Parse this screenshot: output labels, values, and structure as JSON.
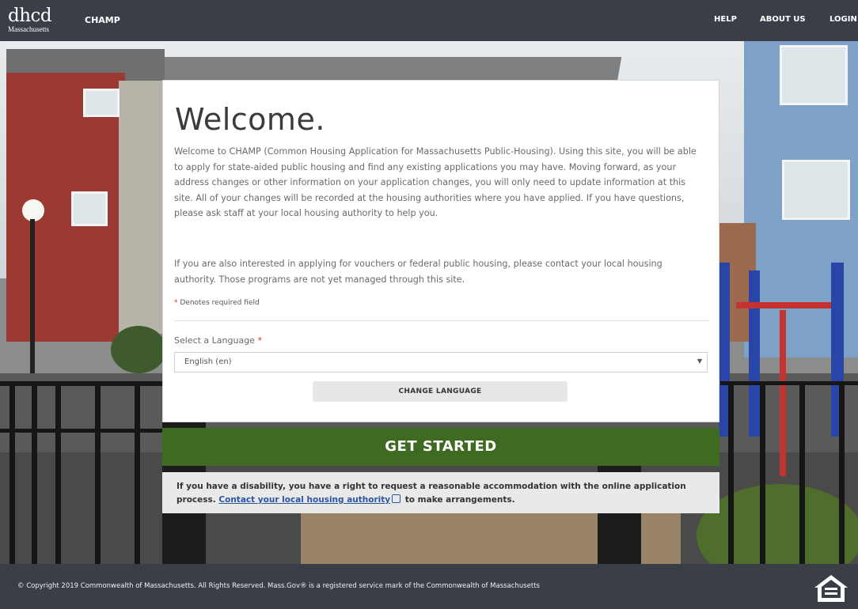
{
  "header": {
    "logo_main": "dhcd",
    "logo_sub": "Massachusetts",
    "brand": "CHAMP",
    "nav": [
      {
        "label": "HELP"
      },
      {
        "label": "ABOUT US"
      },
      {
        "label": "LOGIN"
      }
    ]
  },
  "card": {
    "title": "Welcome.",
    "intro_1": "Welcome to CHAMP (Common Housing Application for Massachusetts Public-Housing). Using this site, you will be able to apply for state-aided public housing and find any existing applications you may have. Moving forward, as your address changes or other information on your application changes, you will only need to update information at this site. All of your changes will be recorded at the housing authorities where you have applied. If you have questions, please ask staff at your local housing authority to help you.",
    "intro_2": "If you are also interested in applying for vouchers or federal public housing, please contact your local housing authority. Those programs are not yet managed through this site.",
    "required_note": "Denotes required field",
    "required_star": "*",
    "language_label": "Select a Language",
    "language_value": "English (en)",
    "change_language_label": "CHANGE LANGUAGE"
  },
  "get_started_label": "GET STARTED",
  "notice": {
    "text_1": "If you have a disability, you have a right to request a reasonable accommodation with the online application process.",
    "link": "Contact your local housing authority",
    "text_2": "to make arrangements."
  },
  "footer": {
    "copyright": "© Copyright 2019 Commonwealth of Massachusetts. All Rights Reserved. Mass.Gov® is a registered service mark of the Commonwealth of Massachusetts"
  },
  "colors": {
    "header_bg": "#3a3f47",
    "get_started_bg": "#3f6a22",
    "link": "#2b55a0"
  }
}
